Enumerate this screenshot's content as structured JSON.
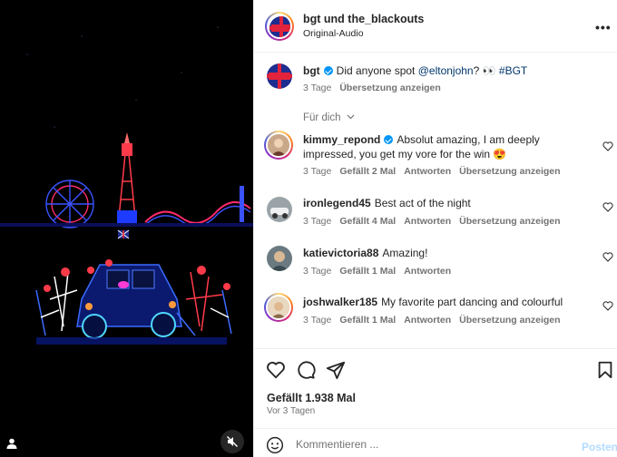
{
  "header": {
    "username": "bgt und the_blackouts",
    "audio": "Original-Audio",
    "more_icon": "more-horizontal-icon"
  },
  "caption": {
    "username": "bgt",
    "verified": true,
    "text_before": "Did anyone spot ",
    "mention": "@eltonjohn",
    "text_after": "? 👀 ",
    "hashtag": "#BGT",
    "age": "3 Tage",
    "translate": "Übersetzung anzeigen"
  },
  "sort_label": "Für dich",
  "comments": [
    {
      "username": "kimmy_repond",
      "verified": true,
      "text": "Absolut amazing, I am deeply impressed, you get my vore for the win 😍",
      "age": "3 Tage",
      "likes": "Gefällt 2 Mal",
      "reply": "Antworten",
      "translate": "Übersetzung anzeigen"
    },
    {
      "username": "ironlegend45",
      "verified": false,
      "text": "Best act of the night",
      "age": "3 Tage",
      "likes": "Gefällt 4 Mal",
      "reply": "Antworten",
      "translate": "Übersetzung anzeigen"
    },
    {
      "username": "katievictoria88",
      "verified": false,
      "text": "Amazing!",
      "age": "3 Tage",
      "likes": "Gefällt 1 Mal",
      "reply": "Antworten",
      "translate": ""
    },
    {
      "username": "joshwalker185",
      "verified": false,
      "text": "My favorite part dancing and colourful",
      "age": "3 Tage",
      "likes": "Gefällt 1 Mal",
      "reply": "Antworten",
      "translate": "Übersetzung anzeigen"
    }
  ],
  "footer": {
    "likes": "Gefällt 1.938 Mal",
    "date": "Vor 3 Tagen"
  },
  "composer": {
    "placeholder": "Kommentieren ...",
    "post": "Posten"
  },
  "colors": {
    "verified": "#0095f6",
    "link": "#00376b",
    "post_disabled": "#b3dbff"
  }
}
